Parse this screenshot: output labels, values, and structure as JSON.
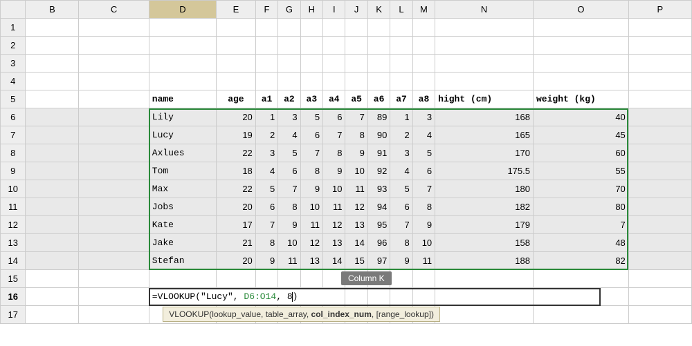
{
  "columns": [
    "B",
    "C",
    "D",
    "E",
    "F",
    "G",
    "H",
    "I",
    "J",
    "K",
    "L",
    "M",
    "N",
    "O",
    "P"
  ],
  "selected_column": "D",
  "rows": [
    1,
    2,
    3,
    4,
    5,
    6,
    7,
    8,
    9,
    10,
    11,
    12,
    13,
    14,
    15,
    16,
    17
  ],
  "header_row": 5,
  "headers": {
    "D": "name",
    "E": "age",
    "F": "a1",
    "G": "a2",
    "H": "a3",
    "I": "a4",
    "J": "a5",
    "K": "a6",
    "L": "a7",
    "M": "a8",
    "N": "hight (cm)",
    "O": "weight (kg)"
  },
  "data_rows": [
    {
      "row": 6,
      "name": "Lily",
      "age": 20,
      "a1": 1,
      "a2": 3,
      "a3": 5,
      "a4": 6,
      "a5": 7,
      "a6": 89,
      "a7": 1,
      "a8": 3,
      "hight": 168,
      "weight": 40
    },
    {
      "row": 7,
      "name": "Lucy",
      "age": 19,
      "a1": 2,
      "a2": 4,
      "a3": 6,
      "a4": 7,
      "a5": 8,
      "a6": 90,
      "a7": 2,
      "a8": 4,
      "hight": 165,
      "weight": 45
    },
    {
      "row": 8,
      "name": "Axlues",
      "age": 22,
      "a1": 3,
      "a2": 5,
      "a3": 7,
      "a4": 8,
      "a5": 9,
      "a6": 91,
      "a7": 3,
      "a8": 5,
      "hight": 170,
      "weight": 60
    },
    {
      "row": 9,
      "name": "Tom",
      "age": 18,
      "a1": 4,
      "a2": 6,
      "a3": 8,
      "a4": 9,
      "a5": 10,
      "a6": 92,
      "a7": 4,
      "a8": 6,
      "hight": 175.5,
      "weight": 55
    },
    {
      "row": 10,
      "name": "Max",
      "age": 22,
      "a1": 5,
      "a2": 7,
      "a3": 9,
      "a4": 10,
      "a5": 11,
      "a6": 93,
      "a7": 5,
      "a8": 7,
      "hight": 180,
      "weight": 70
    },
    {
      "row": 11,
      "name": "Jobs",
      "age": 20,
      "a1": 6,
      "a2": 8,
      "a3": 10,
      "a4": 11,
      "a5": 12,
      "a6": 94,
      "a7": 6,
      "a8": 8,
      "hight": 182,
      "weight": 80
    },
    {
      "row": 12,
      "name": "Kate",
      "age": 17,
      "a1": 7,
      "a2": 9,
      "a3": 11,
      "a4": 12,
      "a5": 13,
      "a6": 95,
      "a7": 7,
      "a8": 9,
      "hight": 179,
      "weight": 7
    },
    {
      "row": 13,
      "name": "Jake",
      "age": 21,
      "a1": 8,
      "a2": 10,
      "a3": 12,
      "a4": 13,
      "a5": 14,
      "a6": 96,
      "a7": 8,
      "a8": 10,
      "hight": 158,
      "weight": 48
    },
    {
      "row": 14,
      "name": "Stefan",
      "age": 20,
      "a1": 9,
      "a2": 11,
      "a3": 13,
      "a4": 14,
      "a5": 15,
      "a6": 97,
      "a7": 9,
      "a8": 11,
      "hight": 188,
      "weight": 82
    }
  ],
  "formula_cell": {
    "row": 16,
    "col": "D",
    "prefix": "=VLOOKUP(\"Lucy\", ",
    "ref": "D6:O14",
    "suffix": ", 8)"
  },
  "column_tooltip": {
    "label": "Column K"
  },
  "func_tooltip": {
    "fn": "VLOOKUP",
    "args": [
      "lookup_value",
      "table_array",
      "col_index_num",
      "[range_lookup]"
    ],
    "current_arg_index": 2
  }
}
